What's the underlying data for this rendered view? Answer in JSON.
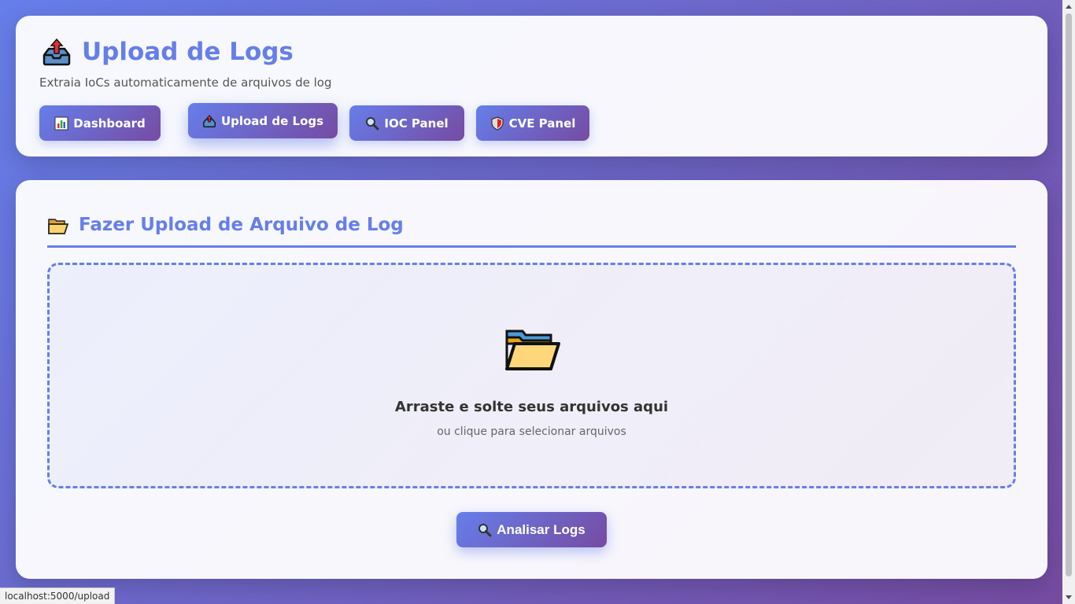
{
  "header": {
    "title": "Upload de Logs",
    "title_icon": "outbox-tray-icon",
    "subtitle": "Extraia IoCs automaticamente de arquivos de log"
  },
  "nav": {
    "items": [
      {
        "label": "Dashboard",
        "icon": "bar-chart-icon",
        "active": false
      },
      {
        "label": "Upload de Logs",
        "icon": "outbox-tray-icon",
        "active": true
      },
      {
        "label": "IOC Panel",
        "icon": "magnifier-icon",
        "active": false
      },
      {
        "label": "CVE Panel",
        "icon": "shield-icon",
        "active": false
      }
    ]
  },
  "upload": {
    "section_title": "Fazer Upload de Arquivo de Log",
    "section_icon": "open-folder-icon",
    "dropzone_title": "Arraste e solte seus arquivos aqui",
    "dropzone_subtitle": "ou clique para selecionar arquivos",
    "analyze_label": "Analisar Logs"
  },
  "status_bar": {
    "url": "localhost:5000/upload"
  },
  "colors": {
    "accent": "#667eea",
    "accent_dark": "#764ba2",
    "card_bg": "#f7f7fc"
  }
}
